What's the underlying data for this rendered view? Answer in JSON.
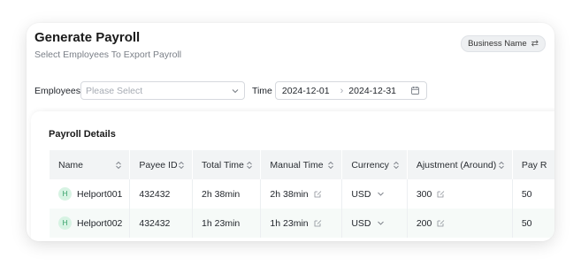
{
  "header": {
    "title": "Generate Payroll",
    "subtitle": "Select Employees To Export Payroll",
    "toggle_label": "Business Name"
  },
  "filters": {
    "employees_label": "Employees",
    "employees_placeholder": "Please Select",
    "time_label": "Time",
    "start_date": "2024-12-01",
    "end_date": "2024-12-31"
  },
  "panel": {
    "title": "Payroll Details"
  },
  "table": {
    "columns": [
      "Name",
      "Payee ID",
      "Total Time",
      "Manual Time",
      "Currency",
      "Ajustment (Around)",
      "Pay R"
    ],
    "rows": [
      {
        "avatar": "H",
        "name": "Helport001",
        "payee_id": "432432",
        "total_time": "2h 38min",
        "manual_time": "2h 38min",
        "currency": "USD",
        "adjustment": "300",
        "pay": "50"
      },
      {
        "avatar": "H",
        "name": "Helport002",
        "payee_id": "432432",
        "total_time": "1h 23min",
        "manual_time": "1h 23min",
        "currency": "USD",
        "adjustment": "200",
        "pay": "50"
      }
    ]
  },
  "colors": {
    "avatar_bg": "#d7f3e3",
    "avatar_fg": "#2e9d64",
    "header_bg": "#f2f4f5"
  }
}
